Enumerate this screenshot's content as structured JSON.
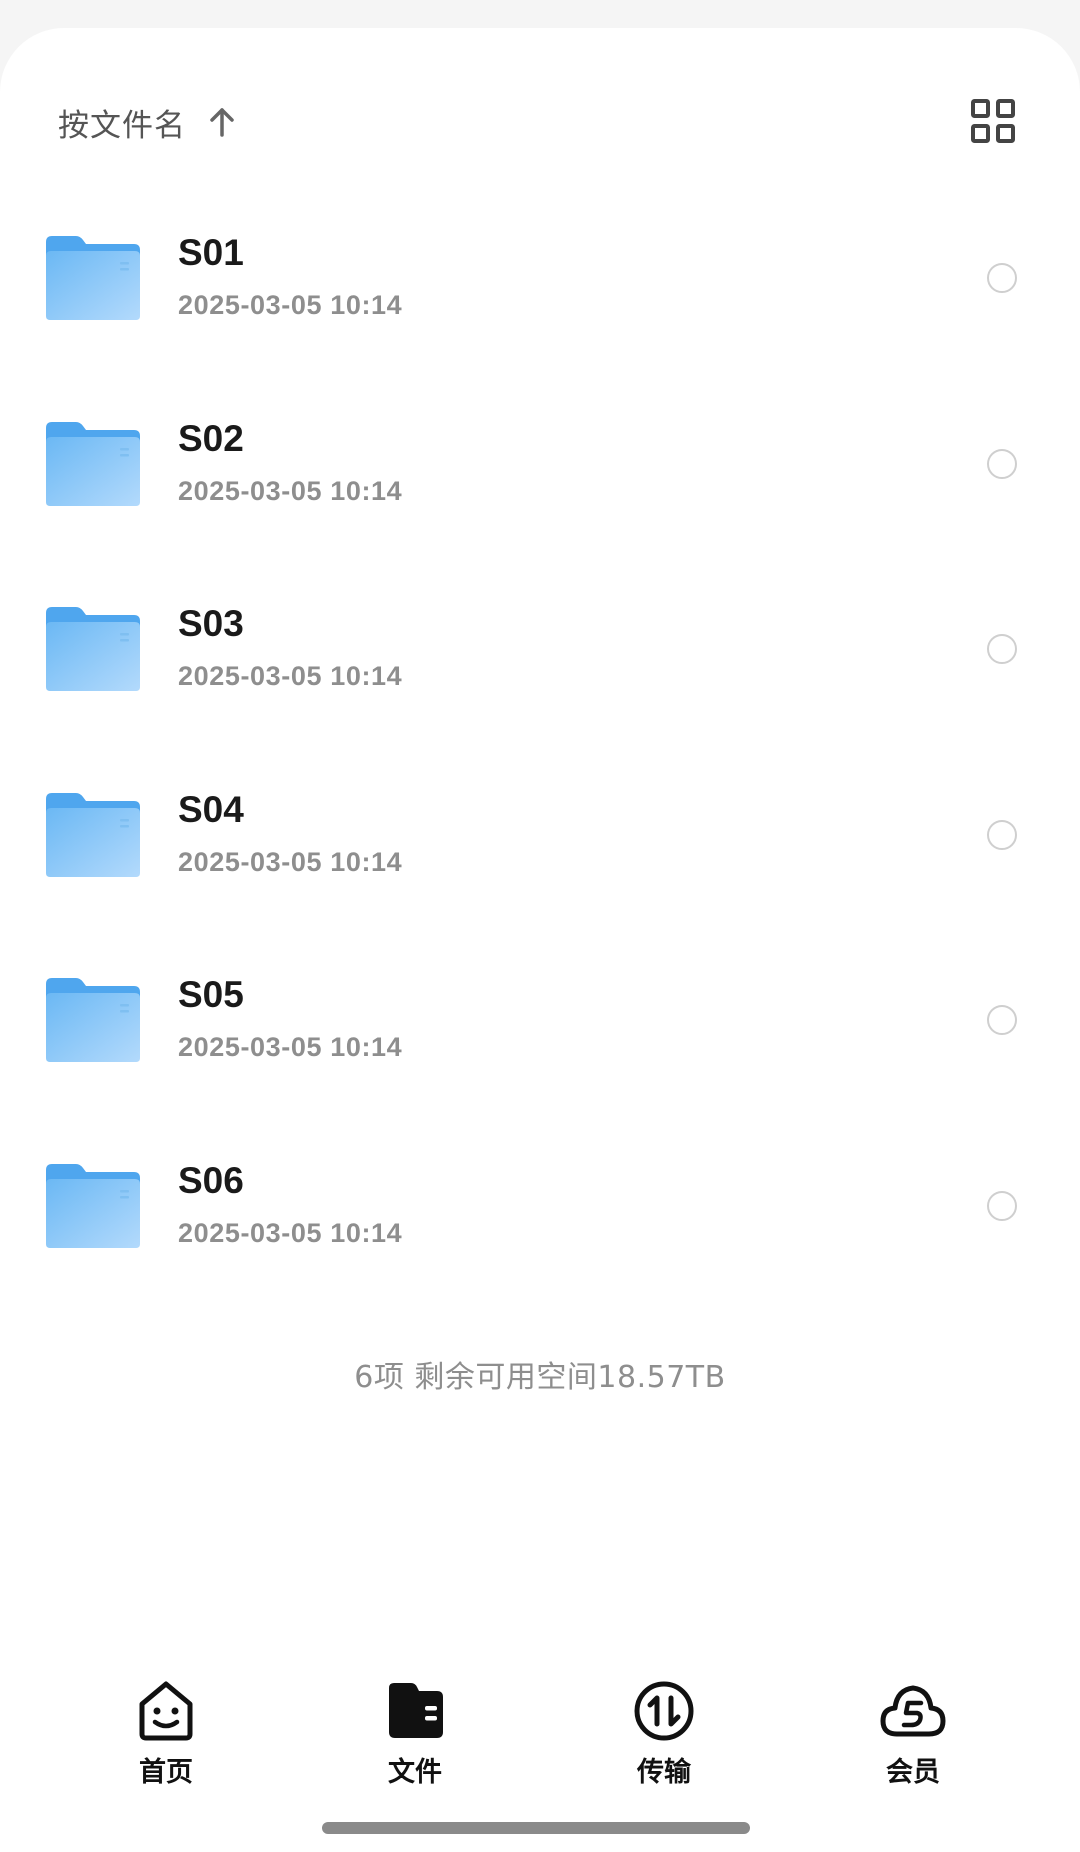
{
  "header": {
    "sort_label": "按文件名",
    "sort_icon": "arrow-up-icon",
    "view_toggle_icon": "grid-view-icon"
  },
  "files": [
    {
      "name": "S01",
      "date": "2025-03-05 10:14"
    },
    {
      "name": "S02",
      "date": "2025-03-05 10:14"
    },
    {
      "name": "S03",
      "date": "2025-03-05 10:14"
    },
    {
      "name": "S04",
      "date": "2025-03-05 10:14"
    },
    {
      "name": "S05",
      "date": "2025-03-05 10:14"
    },
    {
      "name": "S06",
      "date": "2025-03-05 10:14"
    }
  ],
  "summary": "6项 剩余可用空间18.57TB",
  "nav": {
    "home": "首页",
    "files": "文件",
    "transfer": "传输",
    "member": "会员"
  },
  "colors": {
    "folder": "#64b5f6",
    "folder_light": "#a8d4fb",
    "text_primary": "#1a1a1a",
    "text_secondary": "#8e8e8e"
  }
}
